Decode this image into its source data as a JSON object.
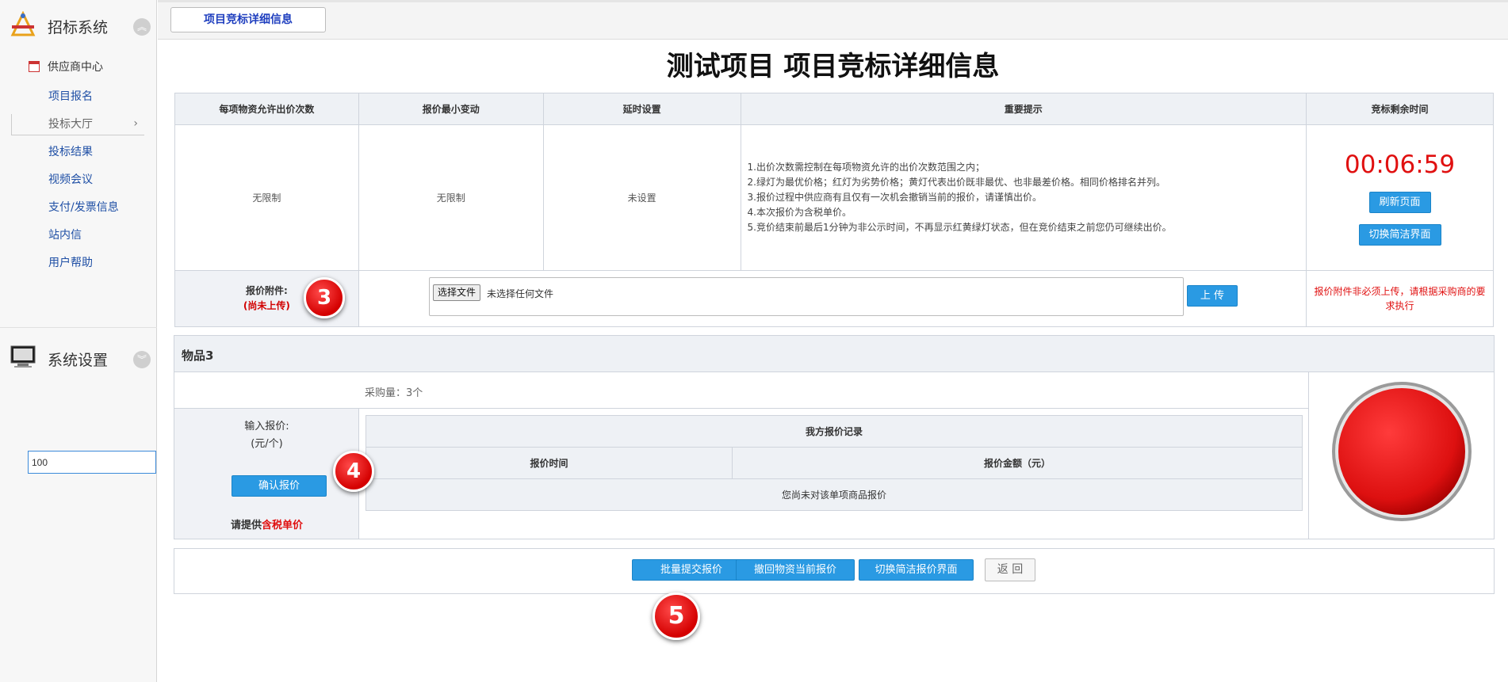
{
  "sidebar": {
    "header_title": "招标系统",
    "sub_header": "供应商中心",
    "items": [
      {
        "label": "项目报名"
      },
      {
        "label": "投标大厅"
      },
      {
        "label": "投标结果"
      },
      {
        "label": "视频会议"
      },
      {
        "label": "支付/发票信息"
      },
      {
        "label": "站内信"
      },
      {
        "label": "用户帮助"
      }
    ],
    "system_title": "系统设置"
  },
  "tabs": {
    "active": "项目竞标详细信息"
  },
  "page": {
    "title": "测试项目 项目竞标详细信息"
  },
  "info_table": {
    "headers": [
      "每项物资允许出价次数",
      "报价最小变动",
      "延时设置",
      "重要提示",
      "竞标剩余时间"
    ],
    "bid_count": "无限制",
    "min_change": "无限制",
    "delay": "未设置",
    "tips": [
      "1.出价次数需控制在每项物资允许的出价次数范围之内；",
      "2.绿灯为最优价格；红灯为劣势价格；黄灯代表出价既非最优、也非最差价格。相同价格排名并列。",
      "3.报价过程中供应商有且仅有一次机会撤销当前的报价，请谨慎出价。",
      "4.本次报价为含税单价。",
      "5.竞价结束前最后1分钟为非公示时间，不再显示红黄绿灯状态，但在竞价结束之前您仍可继续出价。"
    ],
    "countdown": "00:06:59",
    "refresh_label": "刷新页面",
    "switch_simple_label": "切换简洁界面"
  },
  "attachment": {
    "label": "报价附件:",
    "status": "(尚未上传)",
    "choose_file_label": "选择文件",
    "no_file_text": "未选择任何文件",
    "upload_label": "上 传",
    "note": "报价附件非必须上传，请根据采购商的要求执行"
  },
  "item": {
    "name": "物品3",
    "quantity_text": "采购量：3个",
    "input_label": "输入报价:",
    "unit_label": "(元/个)",
    "input_value": "100",
    "confirm_label": "确认报价",
    "hint_prefix": "请提供",
    "hint_emph": "含税单价",
    "record": {
      "title": "我方报价记录",
      "col_time": "报价时间",
      "col_amount": "报价金额（元）",
      "empty_text": "您尚未对该单项商品报价"
    },
    "status_light_color": "#e31b1b"
  },
  "bottom": {
    "batch_submit_label": "批量提交报价",
    "withdraw_label": "撤回物资当前报价",
    "switch_label": "切换简洁报价界面",
    "back_label": "返 回"
  },
  "badges": {
    "three": "3",
    "four": "4",
    "five": "5"
  }
}
